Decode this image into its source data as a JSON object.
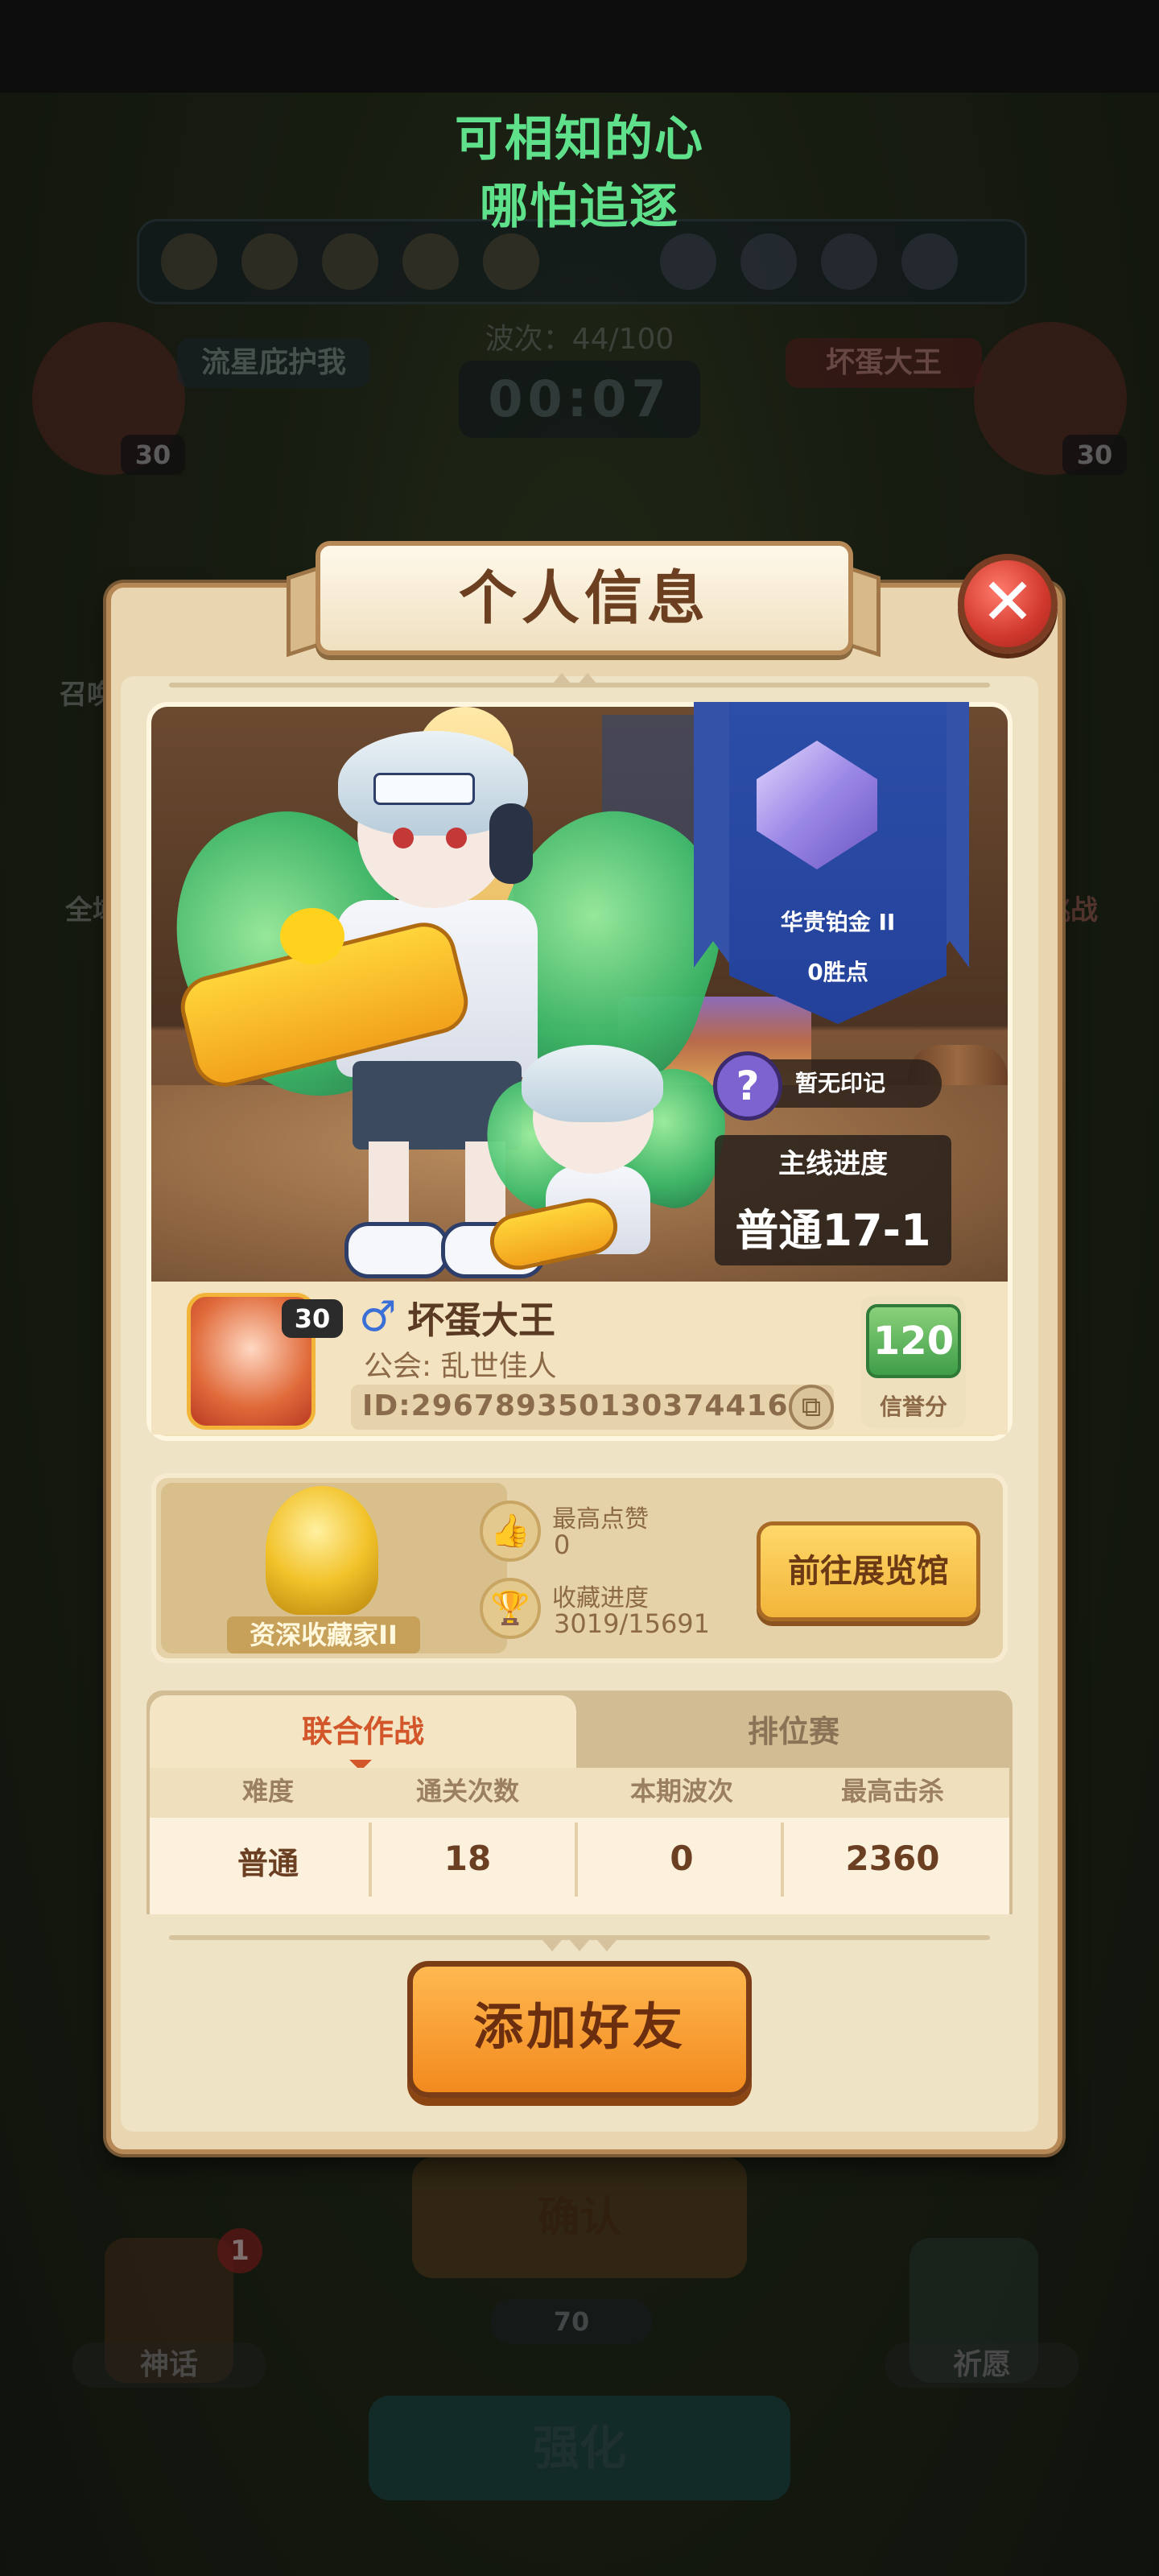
{
  "lyrics": {
    "line1": "可相知的心",
    "line2": "哪怕追逐"
  },
  "background": {
    "wave_text": "波次：44/100",
    "timer": "00:07",
    "left_player_name": "流星庇护我",
    "right_player_name": "坏蛋大王",
    "left_level": "30",
    "right_level": "30",
    "side_left_label": "召唤",
    "side_left_label2": "全域",
    "side_right_label": "挑战",
    "confirm_button": "确认",
    "currency_value": "70",
    "mythic_label": "神话",
    "mythic_badge": "1",
    "pray_label": "祈愿",
    "upgrade_button": "强化"
  },
  "modal": {
    "title": "个人信息",
    "close_icon": "✕",
    "rank": {
      "name": "华贵铂金 II",
      "points": "0胜点"
    },
    "mark": {
      "icon": "?",
      "text": "暂无印记"
    },
    "mainline": {
      "title": "主线进度",
      "value": "普通17-1"
    },
    "player": {
      "level": "30",
      "gender_icon": "♂",
      "name": "坏蛋大王",
      "guild": "公会: 乱世佳人",
      "id": "ID:296789350130374416",
      "credit_score": "120",
      "credit_label": "信誉分"
    },
    "collection": {
      "title": "资深收藏家II",
      "likes_label": "最高点赞",
      "likes_value": "0",
      "progress_label": "收藏进度",
      "progress_value": "3019/15691",
      "gallery_button": "前往展览馆"
    },
    "tabs": [
      {
        "label": "联合作战"
      },
      {
        "label": "排位赛"
      }
    ],
    "table": {
      "headers": [
        "难度",
        "通关次数",
        "本期波次",
        "最高击杀"
      ],
      "row": [
        "普通",
        "18",
        "0",
        "2360"
      ]
    },
    "add_friend_button": "添加好友"
  },
  "colors": {
    "lyrics": "#5fe08b",
    "modal_bg": "#efe3c6",
    "frame": "#b58856",
    "title_text": "#6b3f1f",
    "close_red": "#d1382d",
    "rank_blue": "#2c4ea8",
    "credit_green": "#3f9d48",
    "accent_orange": "#f28a1e",
    "tab_active_text": "#d2562a"
  }
}
